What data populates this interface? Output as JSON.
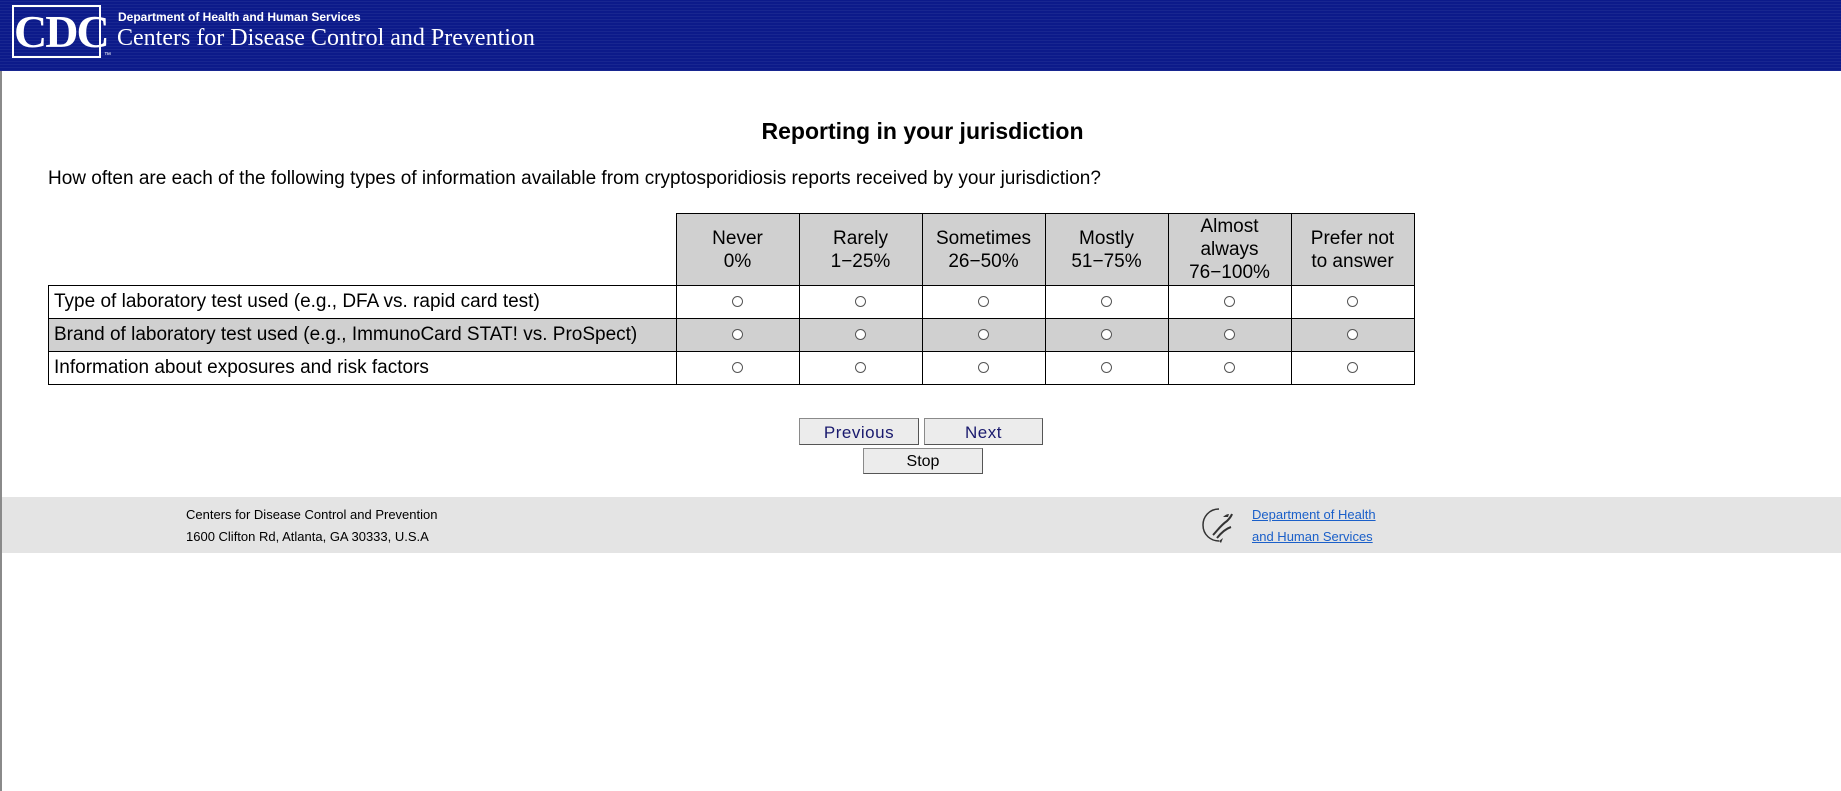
{
  "header": {
    "logo_text": "CDC",
    "logo_mark": "™",
    "department": "Department of Health and Human Services",
    "agency": "Centers for Disease Control and Prevention"
  },
  "page_title": "Reporting in your jurisdiction",
  "question": "How often are each of the following types of information available from cryptosporidiosis reports received by your jurisdiction?",
  "columns": [
    {
      "line1": "Never",
      "line2": "0%",
      "line3": ""
    },
    {
      "line1": "Rarely",
      "line2": "1−25%",
      "line3": ""
    },
    {
      "line1": "Sometimes",
      "line2": "26−50%",
      "line3": ""
    },
    {
      "line1": "Mostly",
      "line2": "51−75%",
      "line3": ""
    },
    {
      "line1": "Almost",
      "line2": "always",
      "line3": "76−100%"
    },
    {
      "line1": "Prefer not",
      "line2": "to answer",
      "line3": ""
    }
  ],
  "rows": [
    {
      "label": "Type of laboratory test used (e.g., DFA vs. rapid card test)"
    },
    {
      "label": "Brand of laboratory test used (e.g., ImmunoCard STAT! vs. ProSpect)"
    },
    {
      "label": "Information about exposures and risk factors"
    }
  ],
  "buttons": {
    "previous": "Previous",
    "next": "Next",
    "stop": "Stop"
  },
  "footer": {
    "address_line1": "Centers for Disease Control and Prevention",
    "address_line2": "1600 Clifton Rd, Atlanta, GA 30333, U.S.A",
    "hhs_link_line1": "Department of Health",
    "hhs_link_line2": "and Human Services",
    "hhs_icon": "hhs-eagle-icon"
  },
  "colors": {
    "header_bg": "#0c1a8a",
    "shade": "#d0d0d0",
    "footer_bg": "#e4e4e4",
    "link": "#1a5fc9"
  }
}
